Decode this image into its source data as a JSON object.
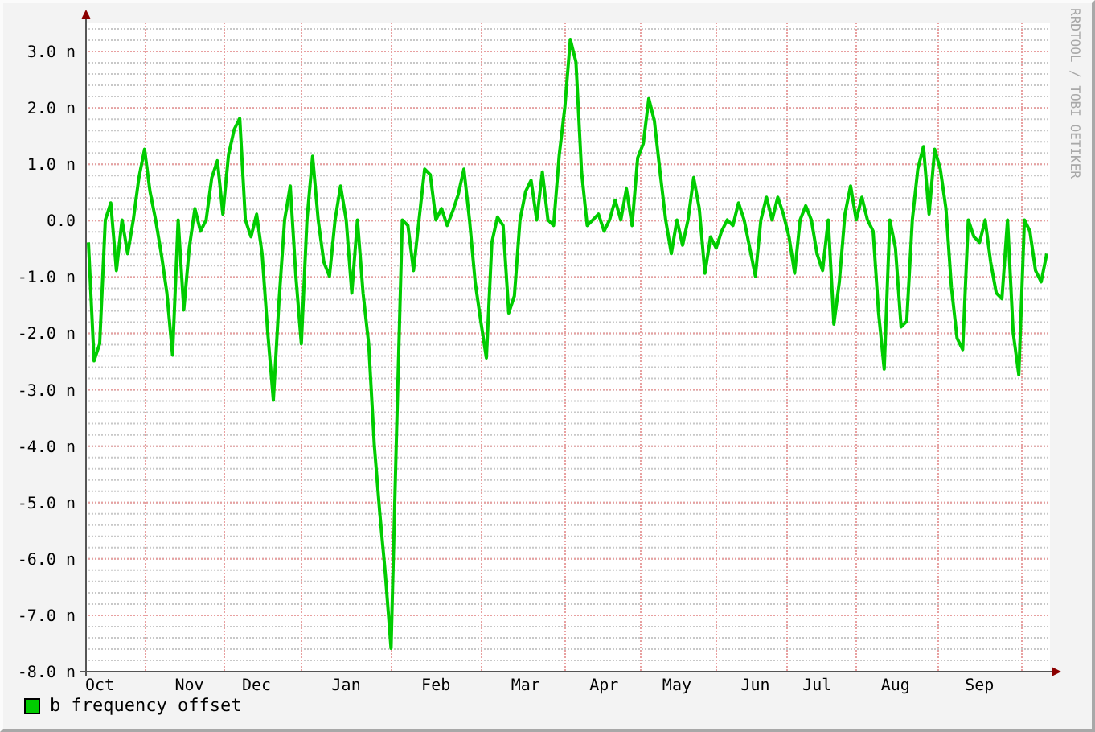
{
  "chart_data": {
    "type": "line",
    "categories": [
      null,
      null,
      "Oct",
      null,
      null,
      null,
      null,
      null,
      null,
      null,
      null,
      null,
      null,
      null,
      null,
      null,
      null,
      null,
      "Nov",
      null,
      null,
      null,
      null,
      null,
      null,
      null,
      null,
      null,
      null,
      null,
      "Dec",
      null,
      null,
      null,
      null,
      null,
      null,
      null,
      null,
      null,
      null,
      null,
      null,
      null,
      null,
      null,
      "Jan",
      null,
      null,
      null,
      null,
      null,
      null,
      null,
      null,
      null,
      null,
      null,
      null,
      null,
      null,
      null,
      "Feb",
      null,
      null,
      null,
      null,
      null,
      null,
      null,
      null,
      null,
      null,
      null,
      null,
      null,
      null,
      null,
      "Mar",
      null,
      null,
      null,
      null,
      null,
      null,
      null,
      null,
      null,
      null,
      null,
      null,
      null,
      "Apr",
      null,
      null,
      null,
      null,
      null,
      null,
      null,
      null,
      null,
      null,
      null,
      null,
      "May",
      null,
      null,
      null,
      null,
      null,
      null,
      null,
      null,
      null,
      null,
      null,
      null,
      null,
      "Jun",
      null,
      null,
      null,
      null,
      null,
      null,
      null,
      null,
      null,
      null,
      "Jul",
      null,
      null,
      null,
      null,
      null,
      null,
      null,
      null,
      null,
      null,
      null,
      null,
      null,
      "Aug",
      null,
      null,
      null,
      null,
      null,
      null,
      null,
      null,
      null,
      null,
      null,
      null,
      null,
      null,
      "Sep",
      null,
      null,
      null,
      null,
      null,
      null,
      null,
      null,
      null,
      null,
      null,
      null
    ],
    "series": [
      {
        "name": "b frequency offset",
        "color": "#00cc00",
        "values": [
          -0.4,
          -2.5,
          -2.2,
          0,
          0.3,
          -0.9,
          0,
          -0.6,
          0,
          0.75,
          1.25,
          0.5,
          0,
          -0.6,
          -1.3,
          -2.4,
          0,
          -1.6,
          -0.5,
          0.2,
          -0.2,
          0,
          0.75,
          1.05,
          0.1,
          1.15,
          1.6,
          1.8,
          0,
          -0.3,
          0.1,
          -0.6,
          -2.0,
          -3.2,
          -1.45,
          0,
          0.6,
          -1.0,
          -2.2,
          0,
          1.13,
          0,
          -0.75,
          -1.0,
          0,
          0.6,
          0,
          -1.3,
          0,
          -1.3,
          -2.2,
          -4.0,
          -5.2,
          -6.3,
          -7.6,
          -3.7,
          0,
          -0.1,
          -0.9,
          0,
          0.9,
          0.8,
          0,
          0.2,
          -0.1,
          0.15,
          0.45,
          0.9,
          0,
          -1.1,
          -1.8,
          -2.45,
          -0.4,
          0.05,
          -0.1,
          -1.65,
          -1.35,
          0,
          0.5,
          0.7,
          0,
          0.85,
          0,
          -0.1,
          1.15,
          2.0,
          3.2,
          2.8,
          0.85,
          -0.1,
          0,
          0.1,
          -0.2,
          0,
          0.35,
          0,
          0.55,
          -0.1,
          1.1,
          1.35,
          2.15,
          1.75,
          0.85,
          0,
          -0.6,
          0,
          -0.45,
          0,
          0.75,
          0.2,
          -0.95,
          -0.3,
          -0.5,
          -0.2,
          0,
          -0.1,
          0.3,
          0,
          -0.5,
          -1.0,
          0,
          0.4,
          0,
          0.4,
          0.1,
          -0.3,
          -0.95,
          0,
          0.25,
          0,
          -0.6,
          -0.9,
          0,
          -1.85,
          -1.1,
          0.1,
          0.6,
          0,
          0.4,
          0,
          -0.2,
          -1.65,
          -2.65,
          0,
          -0.5,
          -1.9,
          -1.8,
          0,
          0.9,
          1.3,
          0.1,
          1.25,
          0.9,
          0.2,
          -1.2,
          -2.1,
          -2.3,
          0,
          -0.3,
          -0.4,
          0,
          -0.75,
          -1.3,
          -1.4,
          0,
          -2.0,
          -2.75,
          0,
          -0.2,
          -0.9,
          -1.1,
          -0.6
        ]
      }
    ],
    "grid": true,
    "ylim": [
      -8,
      3.5
    ],
    "yticks": [
      {
        "value": 3,
        "label": "3.0 n"
      },
      {
        "value": 2,
        "label": "2.0 n"
      },
      {
        "value": 1,
        "label": "1.0 n"
      },
      {
        "value": 0,
        "label": "0.0"
      },
      {
        "value": -1,
        "label": "-1.0 n"
      },
      {
        "value": -2,
        "label": "-2.0 n"
      },
      {
        "value": -3,
        "label": "-3.0 n"
      },
      {
        "value": -4,
        "label": "-4.0 n"
      },
      {
        "value": -5,
        "label": "-5.0 n"
      },
      {
        "value": -6,
        "label": "-6.0 n"
      },
      {
        "value": -7,
        "label": "-7.0 n"
      },
      {
        "value": -8,
        "label": "-8.0 n"
      }
    ]
  },
  "credit": "RRDTOOL / TOBI OETIKER"
}
